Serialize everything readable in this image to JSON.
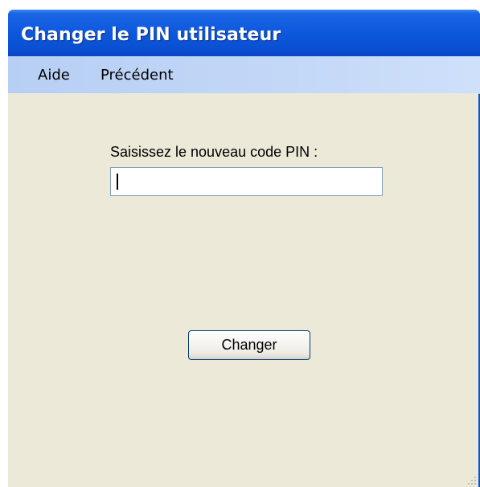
{
  "window": {
    "title": "Changer le PIN utilisateur"
  },
  "menu": {
    "items": [
      {
        "label": "Aide"
      },
      {
        "label": "Précédent"
      }
    ]
  },
  "form": {
    "pin_label": "Saisissez le nouveau code PIN :",
    "pin_value": "",
    "submit_label": "Changer"
  },
  "colors": {
    "titlebar": "#0a52d8",
    "menubar": "#c3d8f7",
    "client_bg": "#ece9d8",
    "input_border": "#7f9db9",
    "button_border": "#003c74"
  }
}
